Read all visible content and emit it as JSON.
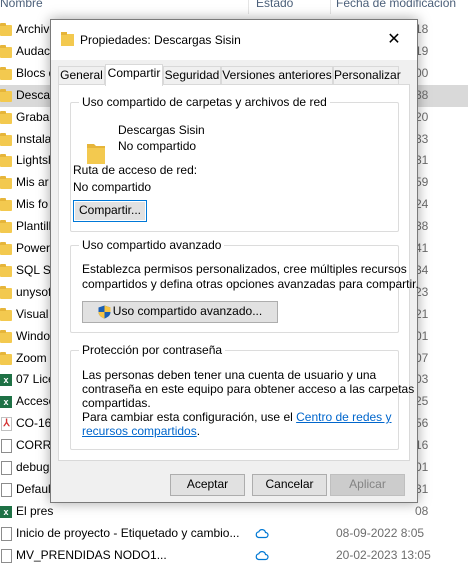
{
  "explorer": {
    "columns": {
      "name": "Nombre",
      "status": "Estado",
      "modified": "Fecha de modificación"
    },
    "rows": [
      {
        "name": "Archivo",
        "date": "18",
        "kind": "folder"
      },
      {
        "name": "Audac",
        "date": "19",
        "kind": "folder"
      },
      {
        "name": "Blocs d",
        "date": "00",
        "kind": "folder"
      },
      {
        "name": "Descar",
        "date": "38",
        "kind": "folder",
        "selected": true
      },
      {
        "name": "Graba",
        "date": "20",
        "kind": "folder"
      },
      {
        "name": "Instala",
        "date": "33",
        "kind": "folder"
      },
      {
        "name": "Lightsh",
        "date": "31",
        "kind": "folder"
      },
      {
        "name": "Mis ar",
        "date": "59",
        "kind": "folder"
      },
      {
        "name": "Mis fo",
        "date": "24",
        "kind": "folder"
      },
      {
        "name": "Plantill",
        "date": "38",
        "kind": "folder"
      },
      {
        "name": "Power",
        "date": "41",
        "kind": "folder"
      },
      {
        "name": "SQL Se",
        "date": "34",
        "kind": "folder"
      },
      {
        "name": "unysof",
        "date": "23",
        "kind": "folder"
      },
      {
        "name": "Visual",
        "date": "21",
        "kind": "folder"
      },
      {
        "name": "Windo",
        "date": "01",
        "kind": "folder"
      },
      {
        "name": "Zoom",
        "date": "07",
        "kind": "folder"
      },
      {
        "name": "07 Lice",
        "date": "03",
        "kind": "xls"
      },
      {
        "name": "Acceso",
        "date": "25",
        "kind": "xls"
      },
      {
        "name": "CO-16",
        "date": "56",
        "kind": "pdf"
      },
      {
        "name": "CORRE",
        "date": "16",
        "kind": "doc"
      },
      {
        "name": "debug",
        "date": "01",
        "kind": "doc"
      },
      {
        "name": "Defaul",
        "date": "31",
        "kind": "doc"
      },
      {
        "name": "El pres",
        "date": "08",
        "kind": "xls"
      },
      {
        "name": "Inicio de proyecto - Etiquetado y cambio...",
        "date": "08-09-2022 8:05",
        "kind": "doc",
        "status": true
      },
      {
        "name": "MV_PRENDIDAS NODO1...",
        "date": "20-02-2023 13:05",
        "kind": "doc",
        "status": true
      }
    ]
  },
  "dialog": {
    "title": "Propiedades: Descargas Sisin",
    "close_glyph": "✕",
    "tabs": [
      "General",
      "Compartir",
      "Seguridad",
      "Versiones anteriores",
      "Personalizar"
    ],
    "active_tab": "Compartir",
    "network_group": {
      "label": "Uso compartido de carpetas y archivos de red",
      "folder_name": "Descargas Sisin",
      "folder_status": "No compartido",
      "path_label": "Ruta de acceso de red:",
      "path_value": "No compartido",
      "share_button": "Compartir..."
    },
    "advanced_group": {
      "label": "Uso compartido avanzado",
      "description_1": "Establezca permisos personalizados, cree múltiples recursos",
      "description_2": "compartidos y defina otras opciones avanzadas para compartir.",
      "button": "Uso compartido avanzado..."
    },
    "password_group": {
      "label": "Protección por contraseña",
      "line_1": "Las personas deben tener una cuenta de usuario y una",
      "line_2": "contraseña en este equipo para obtener acceso a las carpetas",
      "line_3": "compartidas.",
      "line_4_prefix": "Para cambiar esta configuración, use el ",
      "link_part_1": "Centro de redes y",
      "link_part_2": "recursos compartidos",
      "line_5_suffix": "."
    },
    "buttons": {
      "ok": "Aceptar",
      "cancel": "Cancelar",
      "apply": "Aplicar"
    }
  }
}
